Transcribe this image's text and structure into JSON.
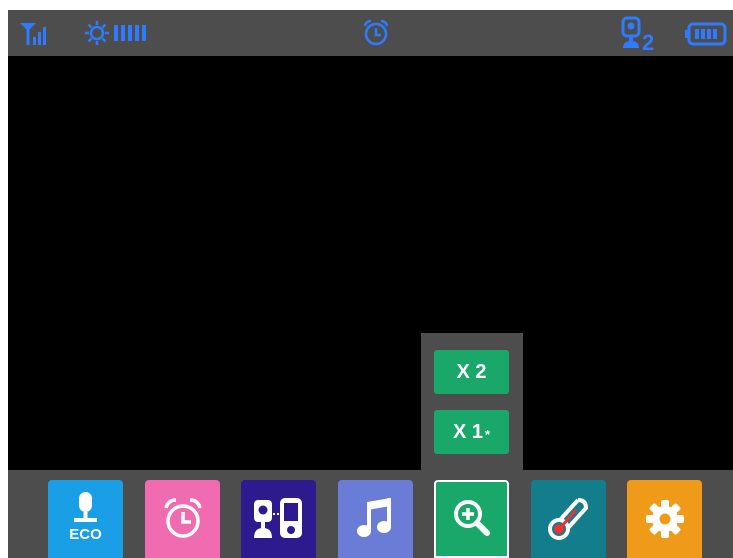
{
  "status_bar": {
    "signal_icon": "signal-strength-icon",
    "brightness_icon": "brightness-level-icon",
    "alarm_icon": "alarm-clock-icon",
    "camera_icon": "camera-number-icon",
    "camera_number": "2",
    "battery_icon": "battery-full-icon",
    "accent_color": "#2f7bff"
  },
  "zoom_menu": {
    "options": [
      {
        "label": "X 2",
        "marker": ""
      },
      {
        "label": "X 1",
        "marker": "*"
      }
    ],
    "color": "#1aa86a"
  },
  "toolbar": {
    "items": [
      {
        "name": "talkback-eco",
        "icon": "microphone-eco-icon",
        "label": "ECO",
        "color": "#1a9fe6"
      },
      {
        "name": "alarm",
        "icon": "alarm-clock-icon",
        "label": "",
        "color": "#f06bb0"
      },
      {
        "name": "camera-pairing",
        "icon": "camera-monitor-icon",
        "label": "",
        "color": "#2d1a8f"
      },
      {
        "name": "lullaby",
        "icon": "music-note-icon",
        "label": "",
        "color": "#6b7cd6"
      },
      {
        "name": "zoom",
        "icon": "zoom-in-icon",
        "label": "",
        "color": "#1aa86a",
        "selected": true
      },
      {
        "name": "temperature",
        "icon": "thermometer-icon",
        "label": "",
        "color": "#137d8c"
      },
      {
        "name": "settings",
        "icon": "gear-icon",
        "label": "",
        "color": "#f09a1a"
      }
    ]
  }
}
